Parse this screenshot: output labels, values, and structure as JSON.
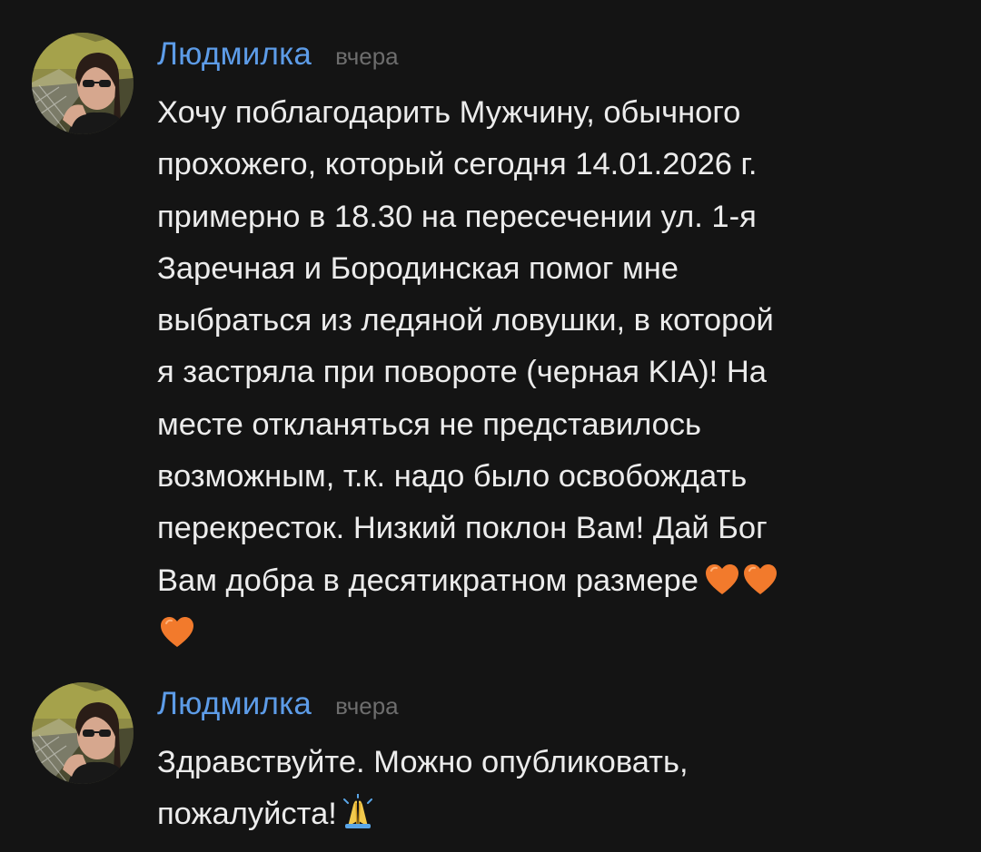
{
  "comments": [
    {
      "author": "Людмилка",
      "time": "вчера",
      "text": "Хочу поблагодарить Мужчину, обычного\nпрохожего, который сегодня 14.01.2026 г.\nпримерно в 18.30 на пересечении ул. 1-я\nЗаречная и Бородинская помог мне\nвыбраться из ледяной ловушки, в которой\nя застряла при повороте (черная KIA)! На\nместе откланяться не представилось\nвозможным, т.к. надо было освобождать\nперекресток. Низкий поклон Вам! Дай Бог\nВам добра в десятикратном размере",
      "emojis": [
        "orange-heart-icon",
        "orange-heart-icon",
        "orange-heart-icon"
      ]
    },
    {
      "author": "Людмилка",
      "time": "вчера",
      "text": "Здравствуйте. Можно опубликовать,\nпожалуйста!",
      "emojis": [
        "folded-hands-icon"
      ]
    }
  ],
  "colors": {
    "background": "#141414",
    "author": "#5d9ce8",
    "time": "#6d6d6d",
    "text": "#ececec",
    "heart": "#f27a2c"
  }
}
